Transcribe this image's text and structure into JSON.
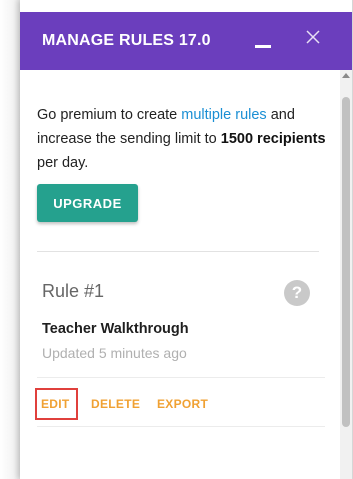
{
  "header": {
    "title": "MANAGE RULES 17.0"
  },
  "promo": {
    "text_before_link": "Go premium to create ",
    "link_text": "multiple rules",
    "text_mid": " and increase the sending limit to ",
    "limit_value": "1500 recipients",
    "text_after": " per day."
  },
  "upgrade": {
    "label": "UPGRADE"
  },
  "rule": {
    "number": "Rule #1",
    "help": "?",
    "name": "Teacher Walkthrough",
    "updated": "Updated 5 minutes ago",
    "actions": {
      "edit": "EDIT",
      "delete": "DELETE",
      "export": "EXPORT"
    }
  },
  "colors": {
    "header_bg": "#6b3ebd",
    "upgrade_bg": "#25a18e",
    "link": "#1a8fd4",
    "action": "#f0a133",
    "highlight": "#e0403c"
  },
  "icons": [
    "minimize-icon",
    "close-icon",
    "help-icon",
    "scroll-up-arrow-icon"
  ]
}
